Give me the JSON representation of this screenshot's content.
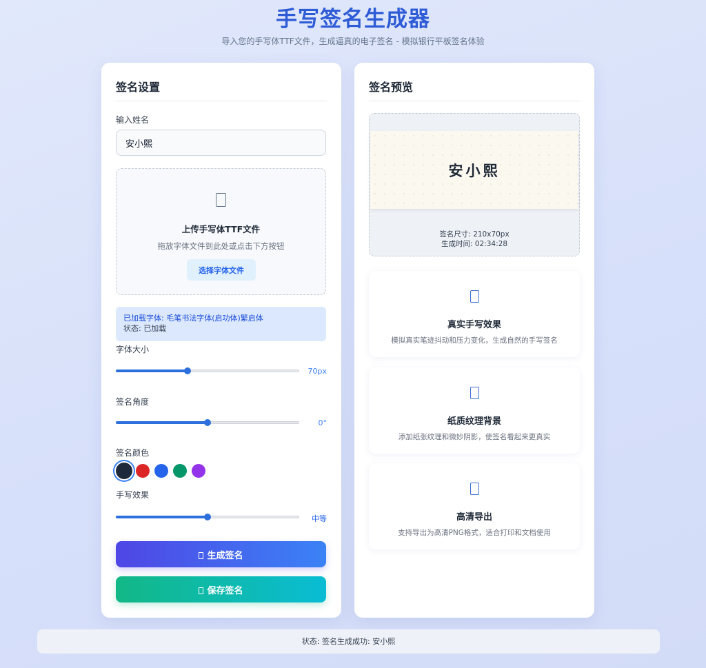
{
  "header": {
    "title": "手写签名生成器",
    "subtitle": "导入您的手写体TTF文件，生成逼真的电子签名 - 模拟银行平板签名体验"
  },
  "settings": {
    "title": "签名设置",
    "name_label": "输入姓名",
    "name_value": "安小熙",
    "upload": {
      "icon": "file-icon",
      "title": "上传手写体TTF文件",
      "hint": "拖放字体文件到此处或点击下方按钮",
      "button_label": "选择字体文件"
    },
    "font_info": {
      "loaded": "已加载字体: 毛笔书法字体(启功体)繁启体",
      "status": "状态: 已加载"
    },
    "font_size": {
      "label": "字体大小",
      "value_text": "70px",
      "fraction": 0.39
    },
    "angle": {
      "label": "签名角度",
      "value_text": "0°",
      "fraction": 0.5
    },
    "color": {
      "label": "签名颜色",
      "options": [
        "#1e293b",
        "#dc2626",
        "#2563eb",
        "#059669",
        "#9333ea"
      ],
      "selected": "#1e293b"
    },
    "effect": {
      "label": "手写效果",
      "value_text": "中等",
      "fraction": 0.5
    },
    "generate_label": "生成签名",
    "save_label": "保存签名",
    "accent_color": "#2d6fdc"
  },
  "preview": {
    "title": "签名预览",
    "signature_text": "安小熙",
    "size_text": "签名尺寸: 210x70px",
    "time_text": "生成时间: 02:34:28"
  },
  "features": [
    {
      "icon": "file-icon",
      "title": "真实手写效果",
      "desc": "模拟真实笔迹抖动和压力变化，生成自然的手写签名"
    },
    {
      "icon": "file-icon",
      "title": "纸质纹理背景",
      "desc": "添加纸张纹理和微妙阴影，使签名看起来更真实"
    },
    {
      "icon": "file-icon",
      "title": "高清导出",
      "desc": "支持导出为高清PNG格式，适合打印和文档使用"
    }
  ],
  "status_bar": {
    "text": "状态: 签名生成成功: 安小熙"
  }
}
